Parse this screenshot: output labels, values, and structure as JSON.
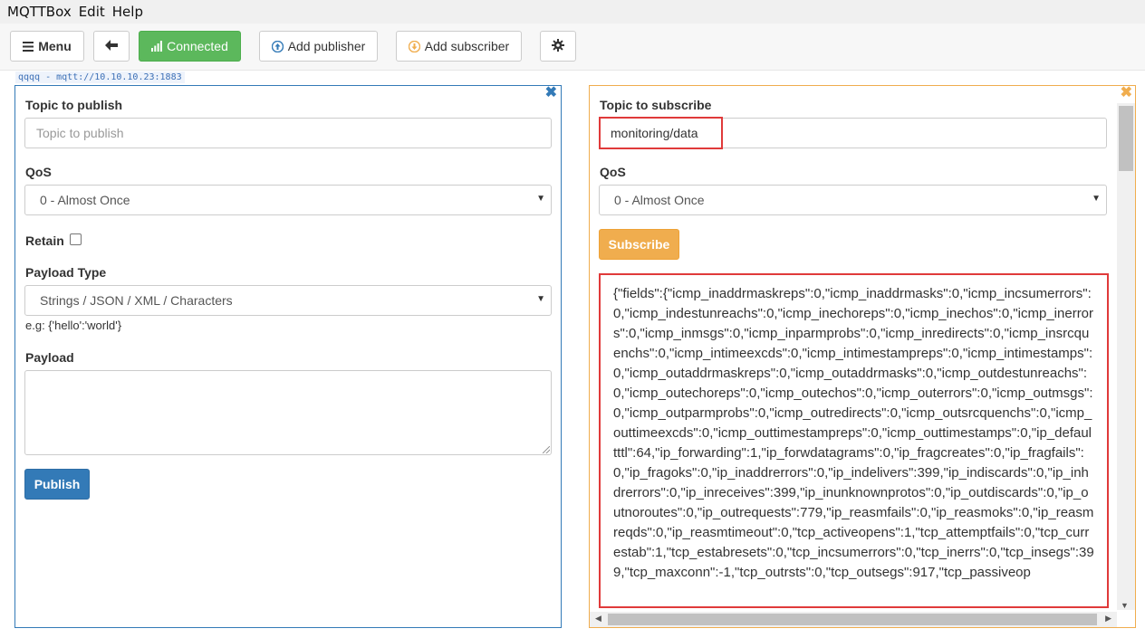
{
  "menubar": {
    "items": [
      "MQTTBox",
      "Edit",
      "Help"
    ]
  },
  "toolbar": {
    "menu_label": "Menu",
    "menu_icon": "hamburger-icon",
    "back_icon": "arrow-left-icon",
    "connected_label": "Connected",
    "connected_icon": "signal-bars-icon",
    "add_publisher_label": "Add publisher",
    "add_publisher_icon": "arrow-circle-up-icon",
    "add_subscriber_label": "Add subscriber",
    "add_subscriber_icon": "arrow-circle-down-icon",
    "settings_icon": "gear-icon"
  },
  "connection_tag": "qqqq - mqtt://10.10.10.23:1883",
  "publisher": {
    "topic_label": "Topic to publish",
    "topic_placeholder": "Topic to publish",
    "qos_label": "QoS",
    "qos_value": "0 - Almost Once",
    "retain_label": "Retain",
    "payload_type_label": "Payload Type",
    "payload_type_value": "Strings / JSON / XML / Characters",
    "payload_hint": "e.g: {'hello':'world'}",
    "payload_label": "Payload",
    "publish_label": "Publish"
  },
  "subscriber": {
    "topic_label": "Topic to subscribe",
    "topic_value": "monitoring/data",
    "qos_label": "QoS",
    "qos_value": "0 - Almost Once",
    "subscribe_label": "Subscribe",
    "message": "{\"fields\":{\"icmp_inaddrmaskreps\":0,\"icmp_inaddrmasks\":0,\"icmp_incsumerrors\":0,\"icmp_indestunreachs\":0,\"icmp_inechoreps\":0,\"icmp_inechos\":0,\"icmp_inerrors\":0,\"icmp_inmsgs\":0,\"icmp_inparmprobs\":0,\"icmp_inredirects\":0,\"icmp_insrcquenchs\":0,\"icmp_intimeexcds\":0,\"icmp_intimestampreps\":0,\"icmp_intimestamps\":0,\"icmp_outaddrmaskreps\":0,\"icmp_outaddrmasks\":0,\"icmp_outdestunreachs\":0,\"icmp_outechoreps\":0,\"icmp_outechos\":0,\"icmp_outerrors\":0,\"icmp_outmsgs\":0,\"icmp_outparmprobs\":0,\"icmp_outredirects\":0,\"icmp_outsrcquenchs\":0,\"icmp_outtimeexcds\":0,\"icmp_outtimestampreps\":0,\"icmp_outtimestamps\":0,\"ip_defaultttl\":64,\"ip_forwarding\":1,\"ip_forwdatagrams\":0,\"ip_fragcreates\":0,\"ip_fragfails\":0,\"ip_fragoks\":0,\"ip_inaddrerrors\":0,\"ip_indelivers\":399,\"ip_indiscards\":0,\"ip_inhdrerrors\":0,\"ip_inreceives\":399,\"ip_inunknownprotos\":0,\"ip_outdiscards\":0,\"ip_outnoroutes\":0,\"ip_outrequests\":779,\"ip_reasmfails\":0,\"ip_reasmoks\":0,\"ip_reasmreqds\":0,\"ip_reasmtimeout\":0,\"tcp_activeopens\":1,\"tcp_attemptfails\":0,\"tcp_currestab\":1,\"tcp_estabresets\":0,\"tcp_incsumerrors\":0,\"tcp_inerrs\":0,\"tcp_insegs\":399,\"tcp_maxconn\":-1,\"tcp_outrsts\":0,\"tcp_outsegs\":917,\"tcp_passiveop"
  },
  "colors": {
    "publisher_accent": "#337ab7",
    "subscriber_accent": "#f0ad4e",
    "connected_green": "#5cb85c",
    "highlight_red": "#e03a3a"
  }
}
